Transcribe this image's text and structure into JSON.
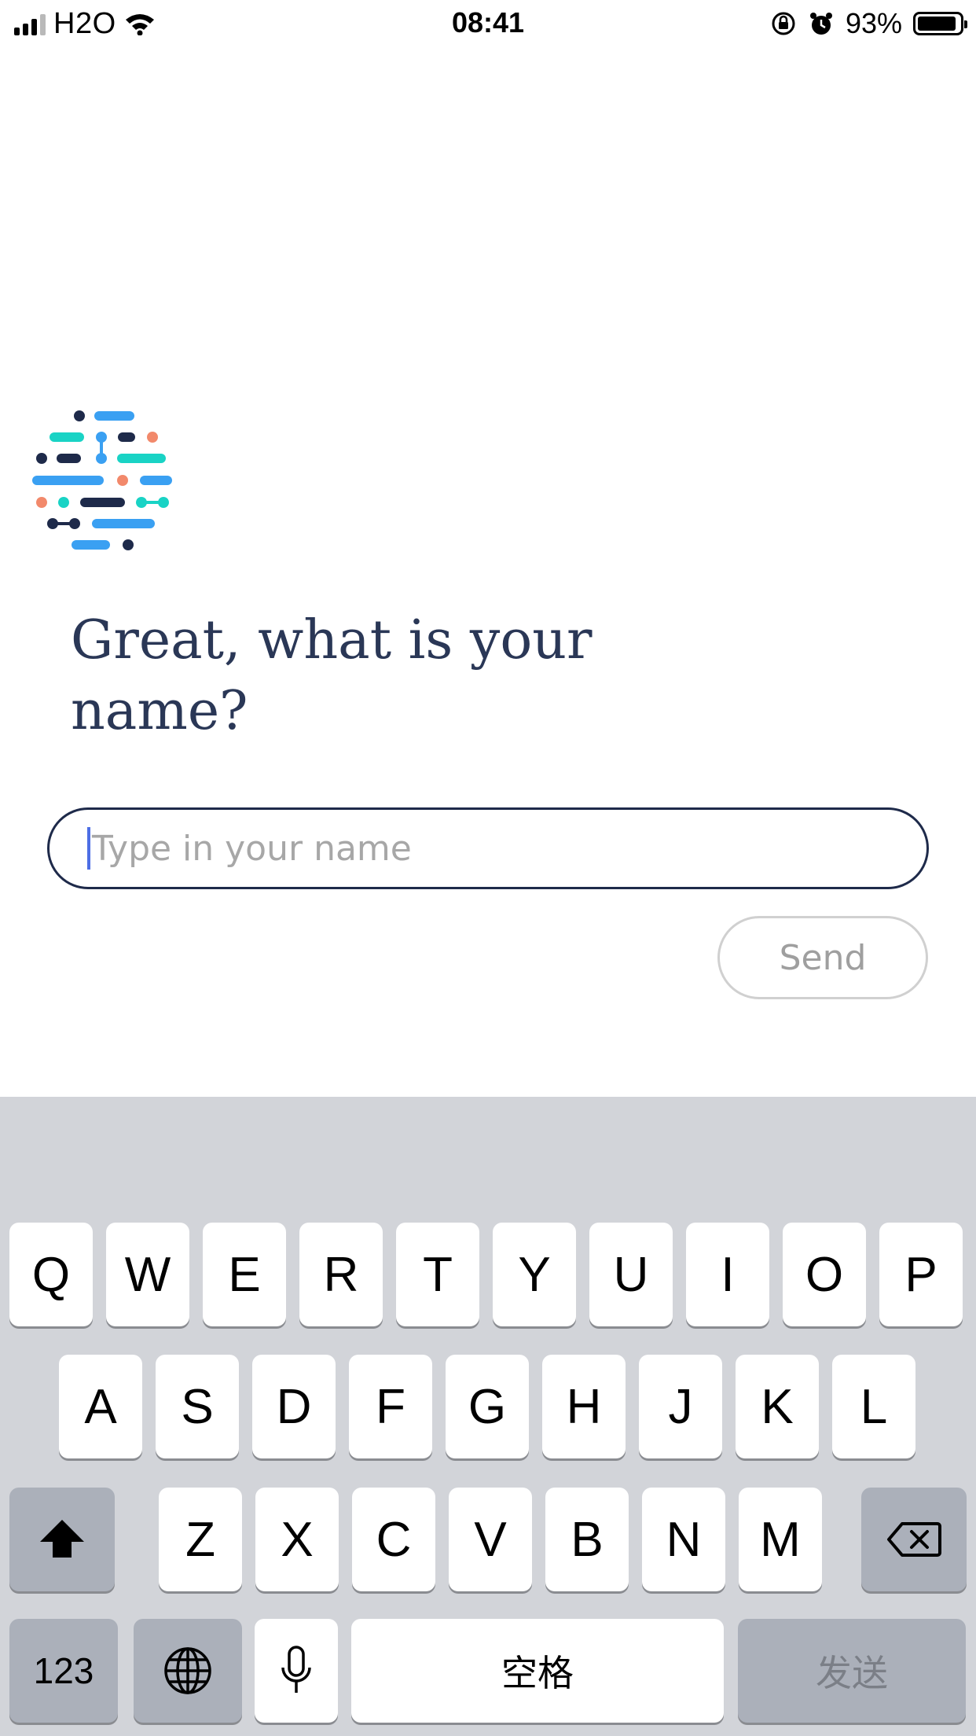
{
  "status_bar": {
    "carrier": "H2O",
    "time": "08:41",
    "battery": "93%",
    "battery_level": 0.93,
    "icons": [
      "signal-icon",
      "wifi-icon",
      "orientation-lock-icon",
      "alarm-icon",
      "battery-icon"
    ]
  },
  "logo": {
    "name": "app-logo",
    "colors": [
      "#1e2a4a",
      "#3aa0f2",
      "#19d3c5",
      "#f2896b"
    ]
  },
  "prompt": {
    "line1": "Great, what is your",
    "line2": "name?"
  },
  "name_input": {
    "placeholder": "Type in your name",
    "value": ""
  },
  "send_button": {
    "label": "Send"
  },
  "keyboard": {
    "row1": [
      "Q",
      "W",
      "E",
      "R",
      "T",
      "Y",
      "U",
      "I",
      "O",
      "P"
    ],
    "row2": [
      "A",
      "S",
      "D",
      "F",
      "G",
      "H",
      "J",
      "K",
      "L"
    ],
    "row3": [
      "Z",
      "X",
      "C",
      "V",
      "B",
      "N",
      "M"
    ],
    "numbers_key": "123",
    "space_key": "空格",
    "return_key": "发送",
    "icons": [
      "shift-icon",
      "backspace-icon",
      "globe-icon",
      "microphone-icon"
    ]
  }
}
